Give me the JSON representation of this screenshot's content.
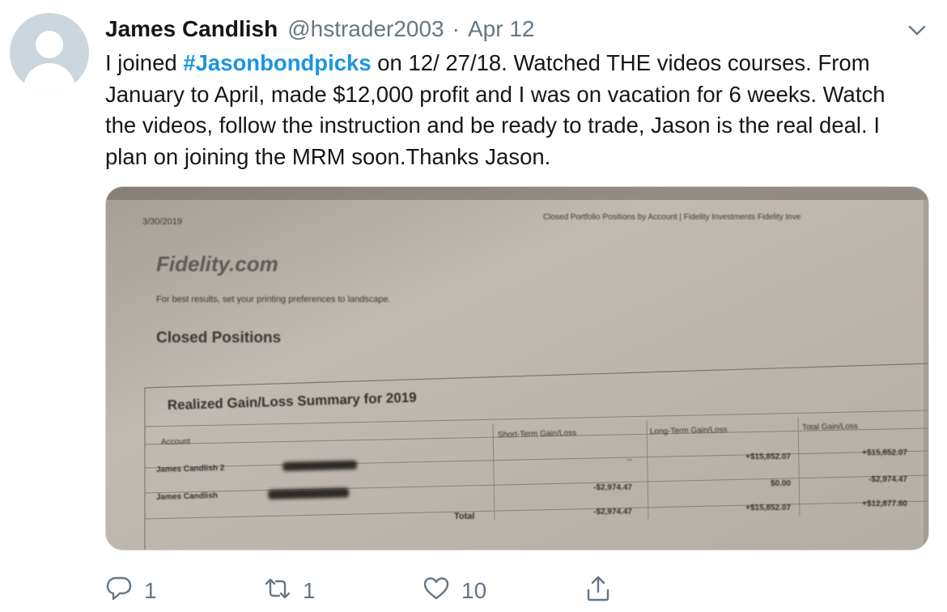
{
  "tweet": {
    "author_name": "James Candlish",
    "handle": "@hstrader2003",
    "separator": "·",
    "date": "Apr 12",
    "text_before": "I joined ",
    "hashtag": "#Jasonbondpicks",
    "text_after": " on 12/ 27/18. Watched THE  videos courses. From January to April, made $12,000 profit and I was on vacation for 6 weeks.  Watch the videos, follow the instruction and be ready to trade, Jason is the real deal. I plan on joining the MRM  soon.Thanks Jason."
  },
  "media": {
    "doc_date": "3/30/2019",
    "doc_header": "Closed Portfolio Positions by Account | Fidelity Investments Fidelity Inve",
    "logo": "Fidelity.com",
    "print_hint": "For best results, set your printing preferences to landscape.",
    "section_title": "Closed Positions",
    "table_title": "Realized Gain/Loss Summary for 2019",
    "columns": [
      "Account",
      "Short-Term Gain/Loss",
      "Long-Term Gain/Loss",
      "Total Gain/Loss"
    ],
    "rows": [
      {
        "account": "James Candlish 2",
        "short_term": "--",
        "long_term": "+$15,852.07",
        "total": "+$15,852.07"
      },
      {
        "account": "James Candlish",
        "short_term": "-$2,974.47",
        "long_term": "$0.00",
        "total": "-$2,974.47"
      }
    ],
    "total_row": {
      "label": "Total",
      "short_term": "-$2,974.47",
      "long_term": "+$15,852.07",
      "total": "+$12,877.60"
    }
  },
  "actions": {
    "reply_count": "1",
    "retweet_count": "1",
    "like_count": "10",
    "reply_icon": "reply-icon",
    "retweet_icon": "retweet-icon",
    "like_icon": "heart-icon",
    "share_icon": "share-icon"
  },
  "colors": {
    "hashtag": "#1b95e0",
    "secondary_text": "#657786",
    "avatar_bg": "#ccd6dd"
  }
}
